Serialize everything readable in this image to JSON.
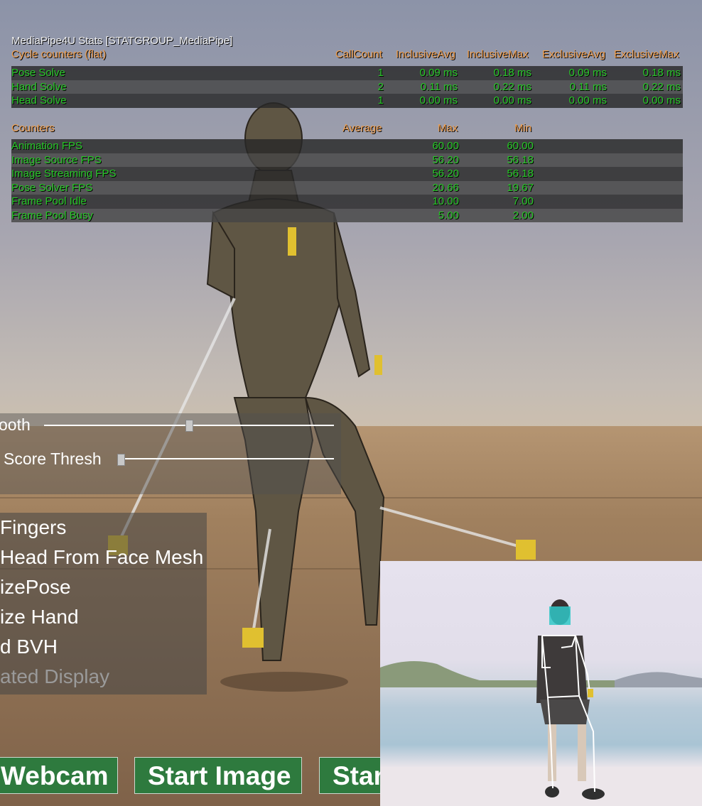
{
  "stats": {
    "title": "MediaPipe4U Stats [STATGROUP_MediaPipe]",
    "cycle_header": [
      "Cycle counters (flat)",
      "CallCount",
      "InclusiveAvg",
      "InclusiveMax",
      "ExclusiveAvg",
      "ExclusiveMax"
    ],
    "cycle_rows": [
      {
        "name": "Pose Solve",
        "count": "1",
        "inc_avg": "0.09 ms",
        "inc_max": "0.18 ms",
        "exc_avg": "0.09 ms",
        "exc_max": "0.18 ms"
      },
      {
        "name": "Hand Solve",
        "count": "2",
        "inc_avg": "0.11 ms",
        "inc_max": "0.22 ms",
        "exc_avg": "0.11 ms",
        "exc_max": "0.22 ms"
      },
      {
        "name": "Head Solve",
        "count": "1",
        "inc_avg": "0.00 ms",
        "inc_max": "0.00 ms",
        "exc_avg": "0.00 ms",
        "exc_max": "0.00 ms"
      }
    ],
    "counter_header": [
      "Counters",
      "Average",
      "Max",
      "Min"
    ],
    "counter_rows": [
      {
        "name": "Animation FPS",
        "max": "60.00",
        "min": "60.00"
      },
      {
        "name": "Image Source FPS",
        "max": "56.20",
        "min": "56.18"
      },
      {
        "name": "Image Streaming FPS",
        "max": "56.20",
        "min": "56.18"
      },
      {
        "name": "Pose Solver FPS",
        "max": "20.66",
        "min": "19.67"
      },
      {
        "name": "Frame Pool Idle",
        "max": "10.00",
        "min": "7.00"
      },
      {
        "name": "Frame Pool Busy",
        "max": "5.00",
        "min": "2.00"
      }
    ]
  },
  "sliders": [
    {
      "label": "ooth",
      "value": 0.5
    },
    {
      "label": "Score Thresh",
      "value": 0.0
    }
  ],
  "options": [
    {
      "label": "Fingers",
      "enabled": true
    },
    {
      "label": "Head From Face Mesh",
      "enabled": true
    },
    {
      "label": "izePose",
      "enabled": true
    },
    {
      "label": "ize Hand",
      "enabled": true
    },
    {
      "label": "d BVH",
      "enabled": true
    },
    {
      "label": "ated Display",
      "enabled": false
    }
  ],
  "buttons": {
    "webcam": "Webcam",
    "image": "Start Image",
    "third": "Star"
  },
  "colors": {
    "stat_value": "#28c828",
    "stat_header": "#f0a050",
    "button_bg": "#2e7a3e",
    "marker": "#e0c030"
  }
}
